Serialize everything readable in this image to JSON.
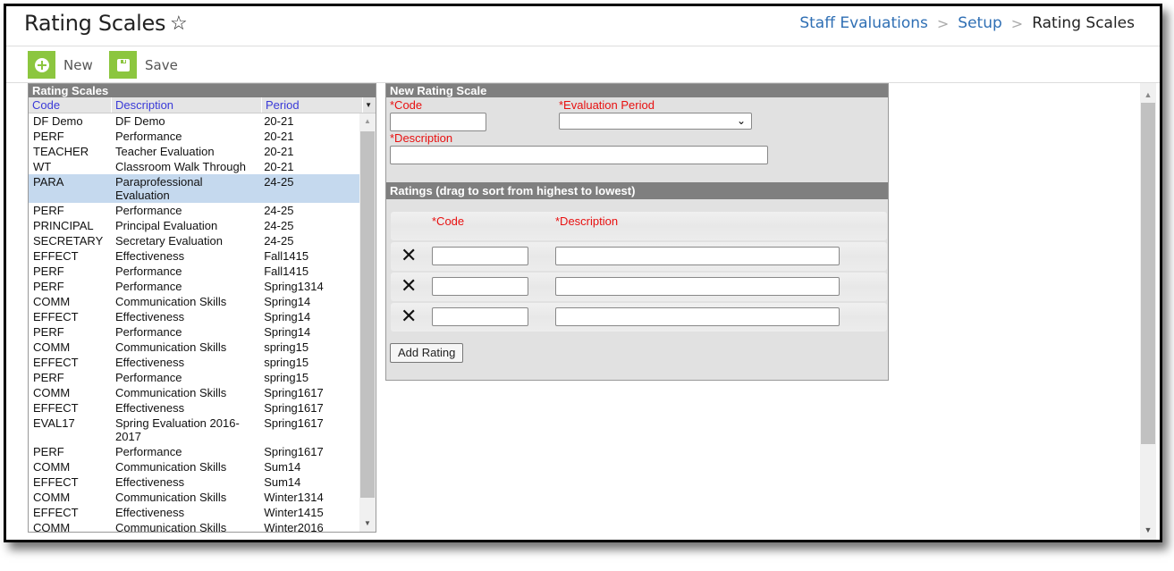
{
  "header": {
    "title": "Rating Scales",
    "favorite_icon": "star-outline-icon",
    "breadcrumb": [
      {
        "label": "Staff Evaluations",
        "link": true
      },
      {
        "label": "Setup",
        "link": true
      },
      {
        "label": "Rating Scales",
        "link": false
      }
    ],
    "breadcrumb_separator": ">"
  },
  "toolbar": {
    "new_label": "New",
    "new_icon": "plus-circle-icon",
    "save_label": "Save",
    "save_icon": "floppy-disk-icon",
    "accent_color": "#8cc63f"
  },
  "list": {
    "title": "Rating Scales",
    "columns": {
      "code": "Code",
      "description": "Description",
      "period": "Period"
    },
    "rows": [
      {
        "code": "DF Demo",
        "description": "DF Demo",
        "period": "20-21"
      },
      {
        "code": "PERF",
        "description": "Performance",
        "period": "20-21"
      },
      {
        "code": "TEACHER",
        "description": "Teacher Evaluation",
        "period": "20-21"
      },
      {
        "code": "WT",
        "description": "Classroom Walk Through",
        "period": "20-21"
      },
      {
        "code": "PARA",
        "description": "Paraprofessional Evaluation",
        "period": "24-25",
        "selected": true
      },
      {
        "code": "PERF",
        "description": "Performance",
        "period": "24-25"
      },
      {
        "code": "PRINCIPAL",
        "description": "Principal Evaluation",
        "period": "24-25"
      },
      {
        "code": "SECRETARY",
        "description": "Secretary Evaluation",
        "period": "24-25"
      },
      {
        "code": "EFFECT",
        "description": "Effectiveness",
        "period": "Fall1415"
      },
      {
        "code": "PERF",
        "description": "Performance",
        "period": "Fall1415"
      },
      {
        "code": "PERF",
        "description": "Performance",
        "period": "Spring1314"
      },
      {
        "code": "COMM",
        "description": "Communication Skills",
        "period": "Spring14"
      },
      {
        "code": "EFFECT",
        "description": "Effectiveness",
        "period": "Spring14"
      },
      {
        "code": "PERF",
        "description": "Performance",
        "period": "Spring14"
      },
      {
        "code": "COMM",
        "description": "Communication Skills",
        "period": "spring15"
      },
      {
        "code": "EFFECT",
        "description": "Effectiveness",
        "period": "spring15"
      },
      {
        "code": "PERF",
        "description": "Performance",
        "period": "spring15"
      },
      {
        "code": "COMM",
        "description": "Communication Skills",
        "period": "Spring1617"
      },
      {
        "code": "EFFECT",
        "description": "Effectiveness",
        "period": "Spring1617"
      },
      {
        "code": "EVAL17",
        "description": "Spring Evaluation 2016-2017",
        "period": "Spring1617"
      },
      {
        "code": "PERF",
        "description": "Performance",
        "period": "Spring1617"
      },
      {
        "code": "COMM",
        "description": "Communication Skills",
        "period": "Sum14"
      },
      {
        "code": "EFFECT",
        "description": "Effectiveness",
        "period": "Sum14"
      },
      {
        "code": "COMM",
        "description": "Communication Skills",
        "period": "Winter1314"
      },
      {
        "code": "EFFECT",
        "description": "Effectiveness",
        "period": "Winter1415"
      },
      {
        "code": "COMM",
        "description": "Communication Skills",
        "period": "Winter2016"
      }
    ],
    "selected_color": "#c5d9ee"
  },
  "form": {
    "title": "New Rating Scale",
    "code_label": "*Code",
    "code_value": "",
    "period_label": "*Evaluation Period",
    "period_value": "",
    "description_label": "*Description",
    "description_value": "",
    "ratings_title": "Ratings (drag to sort from highest to lowest)",
    "ratings_code_label": "*Code",
    "ratings_description_label": "*Description",
    "ratings": [
      {
        "code": "",
        "description": ""
      },
      {
        "code": "",
        "description": ""
      },
      {
        "code": "",
        "description": ""
      }
    ],
    "delete_icon": "x-icon",
    "add_rating_label": "Add Rating",
    "required_color": "#e81010"
  }
}
